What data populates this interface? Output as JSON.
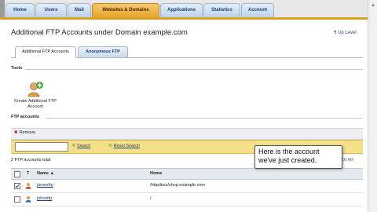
{
  "nav": {
    "tabs": [
      {
        "label": "Home"
      },
      {
        "label": "Users"
      },
      {
        "label": "Mail"
      },
      {
        "label": "Websites & Domains",
        "active": true
      },
      {
        "label": "Applications"
      },
      {
        "label": "Statistics"
      },
      {
        "label": "Account"
      }
    ]
  },
  "page": {
    "title": "Additional FTP Accounts under Domain example.com",
    "up_level": "Up Level"
  },
  "subtabs": [
    {
      "label": "Additional FTP Accounts",
      "active": true
    },
    {
      "label": "Anonymous FTP",
      "active": false
    }
  ],
  "tools": {
    "heading": "Tools",
    "create_label_line1": "Create Additional FTP",
    "create_label_line2": "Account"
  },
  "ftp_accounts": {
    "heading": "FTP accounts",
    "remove_label": "Remove",
    "search_placeholder": "",
    "search_label": "Search",
    "reset_label": "Reset Search",
    "total_label": "2 FTP accounts total",
    "datetime_fragment": "10:21:00 AM",
    "columns": {
      "type": "T",
      "name": "Name",
      "home": "Home"
    },
    "rows": [
      {
        "name": "jamesftp",
        "home": "/httpdocs/shop.example.com",
        "checked": true
      },
      {
        "name": "johnsftp",
        "home": "/",
        "checked": false
      }
    ]
  },
  "tooltip": {
    "line1": "Here is the account",
    "line2": "we've just created."
  },
  "colors": {
    "accent_tab": "#e6a62c",
    "search_bar": "#f5e08a",
    "link": "#1a3d6b"
  }
}
